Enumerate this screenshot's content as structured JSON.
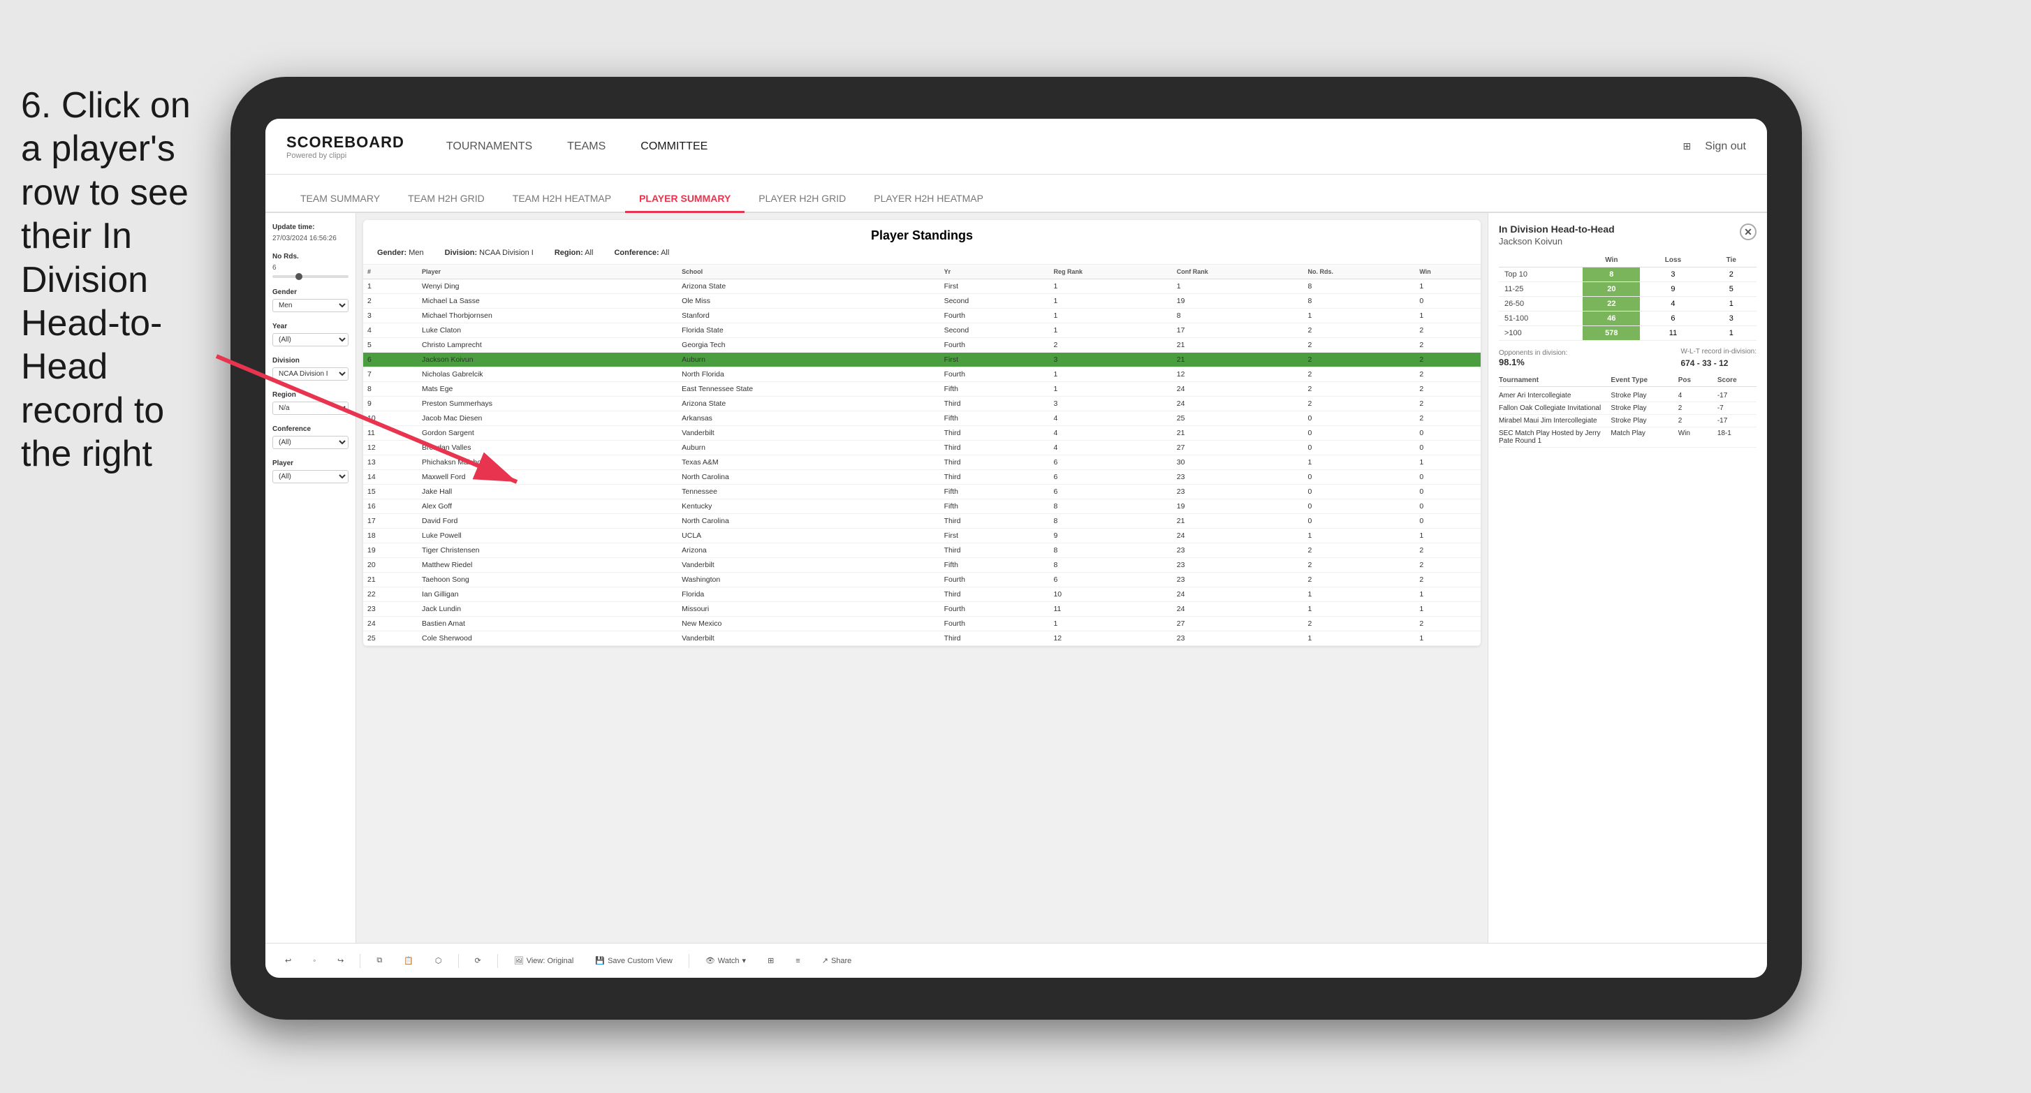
{
  "instruction": {
    "text": "6. Click on a player's row to see their In Division Head-to-Head record to the right"
  },
  "nav": {
    "logo": "SCOREBOARD",
    "logo_sub": "Powered by clippi",
    "items": [
      "TOURNAMENTS",
      "TEAMS",
      "COMMITTEE"
    ],
    "sign_out": "Sign out"
  },
  "tabs": [
    {
      "label": "TEAM SUMMARY",
      "active": false
    },
    {
      "label": "TEAM H2H GRID",
      "active": false
    },
    {
      "label": "TEAM H2H HEATMAP",
      "active": false
    },
    {
      "label": "PLAYER SUMMARY",
      "active": true
    },
    {
      "label": "PLAYER H2H GRID",
      "active": false
    },
    {
      "label": "PLAYER H2H HEATMAP",
      "active": false
    }
  ],
  "sidebar": {
    "update_time_label": "Update time:",
    "update_time": "27/03/2024 16:56:26",
    "no_rds_label": "No Rds.",
    "no_rds_value": "6",
    "gender_label": "Gender",
    "gender_value": "Men",
    "year_label": "Year",
    "year_value": "(All)",
    "division_label": "Division",
    "division_value": "NCAA Division I",
    "region_label": "Region",
    "region_value": "N/a",
    "conference_label": "Conference",
    "conference_value": "(All)",
    "player_label": "Player",
    "player_value": "(All)"
  },
  "standings": {
    "title": "Player Standings",
    "gender_label": "Gender:",
    "gender_value": "Men",
    "division_label": "Division:",
    "division_value": "NCAA Division I",
    "region_label": "Region:",
    "region_value": "All",
    "conference_label": "Conference:",
    "conference_value": "All",
    "columns": [
      "#",
      "Player",
      "School",
      "Yr",
      "Reg Rank",
      "Conf Rank",
      "No. Rds.",
      "Win"
    ],
    "rows": [
      {
        "rank": 1,
        "player": "Wenyi Ding",
        "school": "Arizona State",
        "yr": "First",
        "reg_rank": 1,
        "conf_rank": 1,
        "no_rds": 8,
        "win": 1
      },
      {
        "rank": 2,
        "player": "Michael La Sasse",
        "school": "Ole Miss",
        "yr": "Second",
        "reg_rank": 1,
        "conf_rank": 19,
        "no_rds": 8,
        "win": 0
      },
      {
        "rank": 3,
        "player": "Michael Thorbjornsen",
        "school": "Stanford",
        "yr": "Fourth",
        "reg_rank": 1,
        "conf_rank": 8,
        "no_rds": 1,
        "win": 1
      },
      {
        "rank": 4,
        "player": "Luke Claton",
        "school": "Florida State",
        "yr": "Second",
        "reg_rank": 1,
        "conf_rank": 17,
        "no_rds": 2,
        "win": 2
      },
      {
        "rank": 5,
        "player": "Christo Lamprecht",
        "school": "Georgia Tech",
        "yr": "Fourth",
        "reg_rank": 2,
        "conf_rank": 21,
        "no_rds": 2,
        "win": 2
      },
      {
        "rank": 6,
        "player": "Jackson Koivun",
        "school": "Auburn",
        "yr": "First",
        "reg_rank": 3,
        "conf_rank": 21,
        "no_rds": 2,
        "win": 2,
        "selected": true,
        "highlighted": true
      },
      {
        "rank": 7,
        "player": "Nicholas Gabrelcik",
        "school": "North Florida",
        "yr": "Fourth",
        "reg_rank": 1,
        "conf_rank": 12,
        "no_rds": 2,
        "win": 2
      },
      {
        "rank": 8,
        "player": "Mats Ege",
        "school": "East Tennessee State",
        "yr": "Fifth",
        "reg_rank": 1,
        "conf_rank": 24,
        "no_rds": 2,
        "win": 2
      },
      {
        "rank": 9,
        "player": "Preston Summerhays",
        "school": "Arizona State",
        "yr": "Third",
        "reg_rank": 3,
        "conf_rank": 24,
        "no_rds": 2,
        "win": 2
      },
      {
        "rank": 10,
        "player": "Jacob Mac Diesen",
        "school": "Arkansas",
        "yr": "Fifth",
        "reg_rank": 4,
        "conf_rank": 25,
        "no_rds": 0,
        "win": 2
      },
      {
        "rank": 11,
        "player": "Gordon Sargent",
        "school": "Vanderbilt",
        "yr": "Third",
        "reg_rank": 4,
        "conf_rank": 21,
        "no_rds": 0,
        "win": 0
      },
      {
        "rank": 12,
        "player": "Brendan Valles",
        "school": "Auburn",
        "yr": "Third",
        "reg_rank": 4,
        "conf_rank": 27,
        "no_rds": 0,
        "win": 0
      },
      {
        "rank": 13,
        "player": "Phichaksn Maichon",
        "school": "Texas A&M",
        "yr": "Third",
        "reg_rank": 6,
        "conf_rank": 30,
        "no_rds": 1,
        "win": 1
      },
      {
        "rank": 14,
        "player": "Maxwell Ford",
        "school": "North Carolina",
        "yr": "Third",
        "reg_rank": 6,
        "conf_rank": 23,
        "no_rds": 0,
        "win": 0
      },
      {
        "rank": 15,
        "player": "Jake Hall",
        "school": "Tennessee",
        "yr": "Fifth",
        "reg_rank": 6,
        "conf_rank": 23,
        "no_rds": 0,
        "win": 0
      },
      {
        "rank": 16,
        "player": "Alex Goff",
        "school": "Kentucky",
        "yr": "Fifth",
        "reg_rank": 8,
        "conf_rank": 19,
        "no_rds": 0,
        "win": 0
      },
      {
        "rank": 17,
        "player": "David Ford",
        "school": "North Carolina",
        "yr": "Third",
        "reg_rank": 8,
        "conf_rank": 21,
        "no_rds": 0,
        "win": 0
      },
      {
        "rank": 18,
        "player": "Luke Powell",
        "school": "UCLA",
        "yr": "First",
        "reg_rank": 9,
        "conf_rank": 24,
        "no_rds": 1,
        "win": 1
      },
      {
        "rank": 19,
        "player": "Tiger Christensen",
        "school": "Arizona",
        "yr": "Third",
        "reg_rank": 8,
        "conf_rank": 23,
        "no_rds": 2,
        "win": 2
      },
      {
        "rank": 20,
        "player": "Matthew Riedel",
        "school": "Vanderbilt",
        "yr": "Fifth",
        "reg_rank": 8,
        "conf_rank": 23,
        "no_rds": 2,
        "win": 2
      },
      {
        "rank": 21,
        "player": "Taehoon Song",
        "school": "Washington",
        "yr": "Fourth",
        "reg_rank": 6,
        "conf_rank": 23,
        "no_rds": 2,
        "win": 2
      },
      {
        "rank": 22,
        "player": "Ian Gilligan",
        "school": "Florida",
        "yr": "Third",
        "reg_rank": 10,
        "conf_rank": 24,
        "no_rds": 1,
        "win": 1
      },
      {
        "rank": 23,
        "player": "Jack Lundin",
        "school": "Missouri",
        "yr": "Fourth",
        "reg_rank": 11,
        "conf_rank": 24,
        "no_rds": 1,
        "win": 1
      },
      {
        "rank": 24,
        "player": "Bastien Amat",
        "school": "New Mexico",
        "yr": "Fourth",
        "reg_rank": 1,
        "conf_rank": 27,
        "no_rds": 2,
        "win": 2
      },
      {
        "rank": 25,
        "player": "Cole Sherwood",
        "school": "Vanderbilt",
        "yr": "Third",
        "reg_rank": 12,
        "conf_rank": 23,
        "no_rds": 1,
        "win": 1
      }
    ]
  },
  "h2h_panel": {
    "title": "In Division Head-to-Head",
    "player_name": "Jackson Koivun",
    "table_headers": [
      "Win",
      "Loss",
      "Tie"
    ],
    "rows": [
      {
        "label": "Top 10",
        "win": 8,
        "loss": 3,
        "tie": 2
      },
      {
        "label": "11-25",
        "win": 20,
        "loss": 9,
        "tie": 5
      },
      {
        "label": "26-50",
        "win": 22,
        "loss": 4,
        "tie": 1
      },
      {
        "label": "51-100",
        "win": 46,
        "loss": 6,
        "tie": 3
      },
      {
        "label": ">100",
        "win": 578,
        "loss": 11,
        "tie": 1
      }
    ],
    "opponents_label": "Opponents in division:",
    "record_label": "W-L-T record in-division:",
    "opponents_value": "98.1%",
    "record_value": "674 - 33 - 12",
    "tournaments": {
      "headers": [
        "Tournament",
        "Event Type",
        "Pos",
        "Score"
      ],
      "rows": [
        {
          "name": "Amer Ari Intercollegiate",
          "type": "Stroke Play",
          "pos": 4,
          "score": "-17"
        },
        {
          "name": "Fallon Oak Collegiate Invitational",
          "type": "Stroke Play",
          "pos": 2,
          "score": "-7"
        },
        {
          "name": "Mirabel Maui Jim Intercollegiate",
          "type": "Stroke Play",
          "pos": 2,
          "score": "-17"
        },
        {
          "name": "SEC Match Play Hosted by Jerry Pate Round 1",
          "type": "Match Play",
          "pos": "Win",
          "score": "18-1"
        }
      ]
    }
  },
  "toolbar": {
    "view_label": "View: Original",
    "save_label": "Save Custom View",
    "watch_label": "Watch",
    "share_label": "Share"
  }
}
